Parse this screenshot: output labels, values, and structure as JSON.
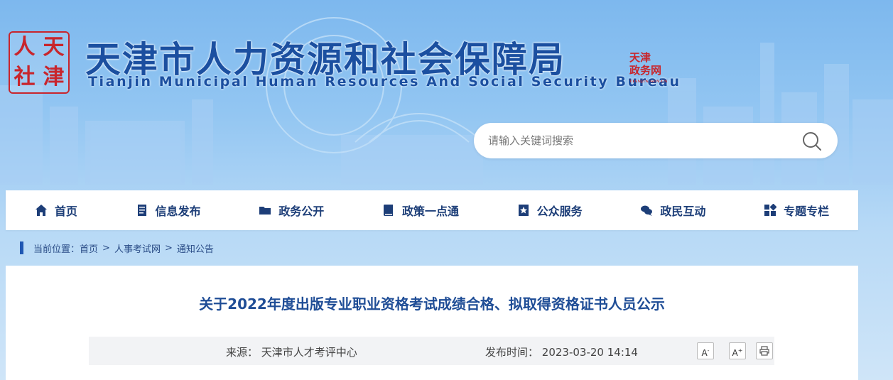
{
  "header": {
    "logo_chars": [
      "人",
      "天",
      "社",
      "津"
    ],
    "title_cn": "天津市人力资源和社会保障局",
    "title_en": "Tianjin Municipal Human Resources And Social Security Bureau",
    "stamp_lines": [
      "天津",
      "政务网"
    ],
    "stamp_sub": "TIANJIN.GOV.CN"
  },
  "search": {
    "placeholder": "请输入关键词搜索",
    "icon": "search-icon"
  },
  "nav": {
    "items": [
      {
        "label": "首页",
        "icon": "home-icon"
      },
      {
        "label": "信息发布",
        "icon": "document-icon"
      },
      {
        "label": "政务公开",
        "icon": "folder-icon"
      },
      {
        "label": "政策一点通",
        "icon": "book-icon"
      },
      {
        "label": "公众服务",
        "icon": "star-badge-icon"
      },
      {
        "label": "政民互动",
        "icon": "chat-icon"
      },
      {
        "label": "专题专栏",
        "icon": "grid-icon"
      }
    ]
  },
  "breadcrumb": {
    "prefix": "当前位置：",
    "items": [
      "首页",
      "人事考试网",
      "通知公告"
    ],
    "separator": ">"
  },
  "article": {
    "title": "关于2022年度出版专业职业资格考试成绩合格、拟取得资格证书人员公示",
    "source_label": "来源：",
    "source_value": "天津市人才考评中心",
    "date_label": "发布时间：",
    "date_value": "2023-03-20 14:14",
    "font_decrease": "A",
    "font_increase": "A",
    "print_icon": "print-icon"
  },
  "colors": {
    "accent": "#1f4d96",
    "nav_text": "#1d3e78",
    "seal_red": "#c8252c"
  }
}
